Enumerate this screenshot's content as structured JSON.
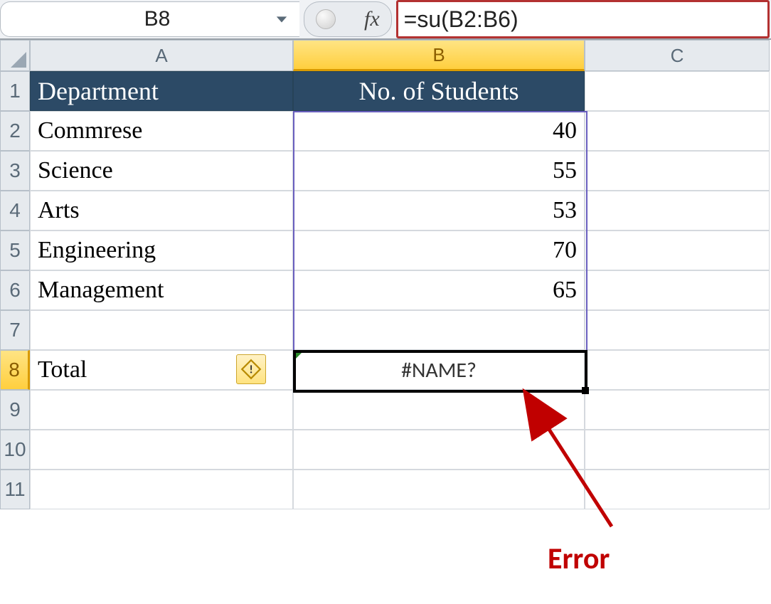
{
  "formula_bar": {
    "cell_ref": "B8",
    "formula": "=su(B2:B6)",
    "fx_symbol": "fx"
  },
  "columns": [
    "A",
    "B",
    "C"
  ],
  "rows": [
    "1",
    "2",
    "3",
    "4",
    "5",
    "6",
    "7",
    "8",
    "9",
    "10",
    "11"
  ],
  "headers": {
    "A": "Department",
    "B": "No. of Students"
  },
  "data": [
    {
      "dept": "Commrese",
      "students": "40"
    },
    {
      "dept": "Science",
      "students": "55"
    },
    {
      "dept": "Arts",
      "students": "53"
    },
    {
      "dept": "Engineering",
      "students": "70"
    },
    {
      "dept": "Management",
      "students": "65"
    }
  ],
  "total_row": {
    "label": "Total",
    "value": "#NAME?"
  },
  "annotation": {
    "label": "Error"
  },
  "selected_cell": "B8",
  "range_highlight": "B2:B7"
}
